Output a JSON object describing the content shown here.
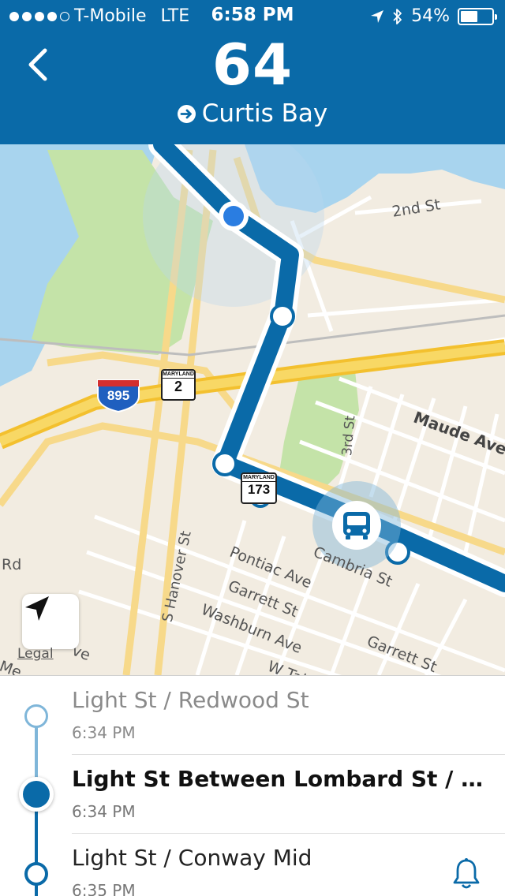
{
  "status_bar": {
    "carrier": "T-Mobile",
    "network": "LTE",
    "time": "6:58 PM",
    "battery_percent_label": "54%",
    "battery_level": 0.54,
    "signal_bars_filled": 4,
    "signal_bars_total": 5
  },
  "header": {
    "route_number": "64",
    "destination": "Curtis Bay",
    "back_icon": "chevron-left-icon",
    "background_color": "#0a6aa8"
  },
  "map": {
    "street_labels": {
      "second_st": "2nd St",
      "third_st": "3rd St",
      "maude_ave": "Maude Ave",
      "s_hanover_st": "S Hanover St",
      "pontiac_ave": "Pontiac Ave",
      "cambria_st": "Cambria St",
      "garrett_st_1": "Garrett St",
      "garrett_st_2": "Garrett St",
      "washburn_ave": "Washburn Ave",
      "w_tal": "W Tal",
      "rd": "Rd",
      "ve": "ve",
      "me": "Me"
    },
    "shields": {
      "interstate": "895",
      "maryland_2_state": "MARYLAND",
      "maryland_2": "2",
      "maryland_173_state": "MARYLAND",
      "maryland_173": "173"
    },
    "legal": "Legal",
    "route_color": "#0a6aa8"
  },
  "stops": [
    {
      "name": "Light St / Redwood St",
      "time": "6:34 PM",
      "state": "past"
    },
    {
      "name": "Light St Between Lombard St / P...",
      "time": "6:34 PM",
      "state": "current"
    },
    {
      "name": "Light St / Conway Mid",
      "time": "6:35 PM",
      "state": "upcoming"
    }
  ]
}
